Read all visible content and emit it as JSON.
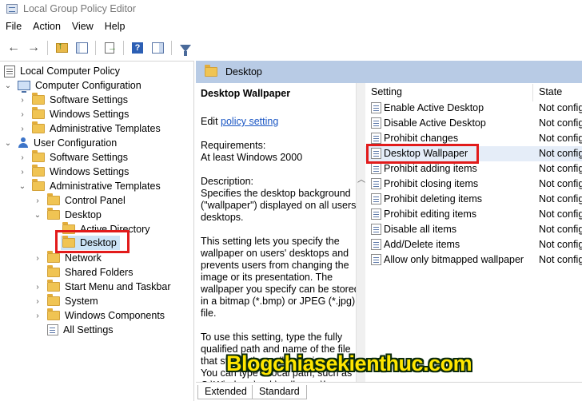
{
  "window": {
    "title": "Local Group Policy Editor",
    "icon": "policy-editor-icon"
  },
  "menu": [
    "File",
    "Action",
    "View",
    "Help"
  ],
  "toolbar": {
    "buttons": [
      "back-arrow",
      "forward-arrow",
      "up-folder-icon",
      "show-hide-tree-icon",
      "export-list-icon",
      "help-icon",
      "properties-pane-icon",
      "filter-icon"
    ]
  },
  "tree": {
    "root": "Local Computer Policy",
    "computer_config": "Computer Configuration",
    "cc_software": "Software Settings",
    "cc_windows": "Windows Settings",
    "cc_admin": "Administrative Templates",
    "user_config": "User Configuration",
    "uc_software": "Software Settings",
    "uc_windows": "Windows Settings",
    "uc_admin": "Administrative Templates",
    "control_panel": "Control Panel",
    "desktop": "Desktop",
    "active_directory": "Active Directory",
    "desktop_child": "Desktop",
    "network": "Network",
    "shared_folders": "Shared Folders",
    "start_menu": "Start Menu and Taskbar",
    "system": "System",
    "windows_components": "Windows Components",
    "all_settings": "All Settings"
  },
  "header": {
    "title": "Desktop"
  },
  "description": {
    "title": "Desktop Wallpaper",
    "edit_prefix": "Edit",
    "edit_link": "policy setting",
    "requirements_label": "Requirements:",
    "requirements_value": "At least Windows 2000",
    "description_label": "Description:",
    "p1": "Specifies the desktop background (\"wallpaper\") displayed on all users' desktops.",
    "p2": "This setting lets you specify the wallpaper on users' desktops and prevents users from changing the image or its presentation. The wallpaper you specify can be stored in a bitmap (*.bmp) or JPEG (*.jpg) file.",
    "p3": "To use this setting, type the fully qualified path and name of the file that stores the wallpaper image. You can type a local path, such as C:\\Windows\\web\\wallpaper\\home"
  },
  "list": {
    "col_setting": "Setting",
    "col_state": "State",
    "rows": [
      {
        "name": "Enable Active Desktop",
        "state": "Not configured"
      },
      {
        "name": "Disable Active Desktop",
        "state": "Not configured"
      },
      {
        "name": "Prohibit changes",
        "state": "Not configured"
      },
      {
        "name": "Desktop Wallpaper",
        "state": "Not configured"
      },
      {
        "name": "Prohibit adding items",
        "state": "Not configured"
      },
      {
        "name": "Prohibit closing items",
        "state": "Not configured"
      },
      {
        "name": "Prohibit deleting items",
        "state": "Not configured"
      },
      {
        "name": "Prohibit editing items",
        "state": "Not configured"
      },
      {
        "name": "Disable all items",
        "state": "Not configured"
      },
      {
        "name": "Add/Delete items",
        "state": "Not configured"
      },
      {
        "name": "Allow only bitmapped wallpaper",
        "state": "Not configured"
      }
    ]
  },
  "tabs": [
    "Extended",
    "Standard"
  ],
  "watermark": "Blogchiasekienthuc.com",
  "colors": {
    "header_band": "#b8cbe5",
    "highlight_box": "#e21b1b",
    "link": "#1a56c4",
    "selection": "#cce4f7"
  }
}
